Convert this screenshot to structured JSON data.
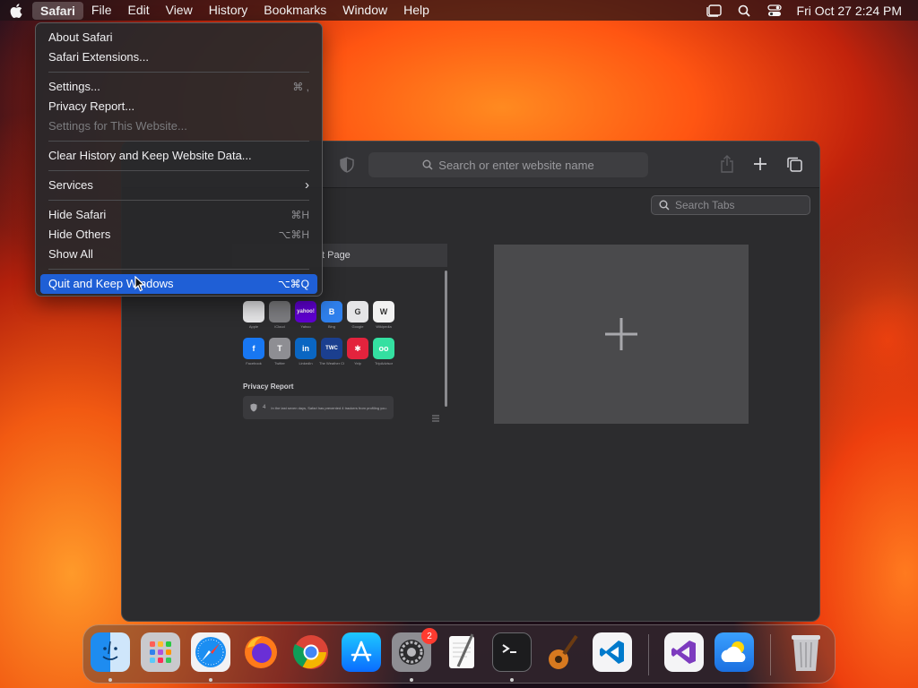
{
  "menubar": {
    "items": [
      "Safari",
      "File",
      "Edit",
      "View",
      "History",
      "Bookmarks",
      "Window",
      "Help"
    ],
    "clock": "Fri Oct 27  2:24 PM",
    "icons": [
      "stage-manager-icon",
      "spotlight-search-icon",
      "control-center-icon"
    ]
  },
  "safari_menu": {
    "groups": [
      [
        {
          "label": "About Safari",
          "shortcut": ""
        },
        {
          "label": "Safari Extensions...",
          "shortcut": ""
        }
      ],
      [
        {
          "label": "Settings...",
          "shortcut": "⌘ ,"
        },
        {
          "label": "Privacy Report...",
          "shortcut": ""
        },
        {
          "label": "Settings for This Website...",
          "shortcut": "",
          "disabled": true
        }
      ],
      [
        {
          "label": "Clear History and Keep Website Data...",
          "shortcut": ""
        }
      ],
      [
        {
          "label": "Services",
          "shortcut": "›"
        }
      ],
      [
        {
          "label": "Hide Safari",
          "shortcut": "⌘H"
        },
        {
          "label": "Hide Others",
          "shortcut": "⌥⌘H"
        },
        {
          "label": "Show All",
          "shortcut": ""
        }
      ],
      [
        {
          "label": "Quit and Keep Windows",
          "shortcut": "⌥⌘Q",
          "highlighted": true
        }
      ]
    ]
  },
  "window": {
    "address_placeholder": "Search or enter website name",
    "search_tabs_placeholder": "Search Tabs",
    "tab_card_title": "t Page",
    "favorites": [
      {
        "label": "Apple",
        "color": "#e5e5e7",
        "glyph": ""
      },
      {
        "label": "iCloud",
        "color": "#7d7d80",
        "glyph": ""
      },
      {
        "label": "Yahoo",
        "color": "#5f01d1",
        "glyph": "yahoo!"
      },
      {
        "label": "Bing",
        "color": "#2f80ed",
        "glyph": "B"
      },
      {
        "label": "Google",
        "color": "#e5e5e7",
        "glyph": "G"
      },
      {
        "label": "Wikipedia",
        "color": "#f2f2f2",
        "glyph": "W"
      },
      {
        "label": "Facebook",
        "color": "#1877f2",
        "glyph": "f"
      },
      {
        "label": "Twitter",
        "color": "#8e8e93",
        "glyph": "T"
      },
      {
        "label": "LinkedIn",
        "color": "#0a66c2",
        "glyph": "in"
      },
      {
        "label": "The Weather Channel",
        "color": "#1b3f8f",
        "glyph": "TWC"
      },
      {
        "label": "Yelp",
        "color": "#e3233d",
        "glyph": "✱"
      },
      {
        "label": "TripAdvisor",
        "color": "#34e0a1",
        "glyph": "oo"
      }
    ],
    "privacy_title": "Privacy Report",
    "privacy_text": "In the last seven days, Safari has prevented 4 trackers from profiling you.",
    "privacy_count": "4"
  },
  "dock": {
    "apps": [
      "Finder",
      "Launchpad",
      "Safari",
      "Firefox",
      "Chrome",
      "App Store",
      "System Settings",
      "TextEdit",
      "Terminal",
      "GarageBand",
      "Visual Studio Code",
      "Visual Studio",
      "Weather",
      "Trash"
    ],
    "settings_badge": "2"
  }
}
